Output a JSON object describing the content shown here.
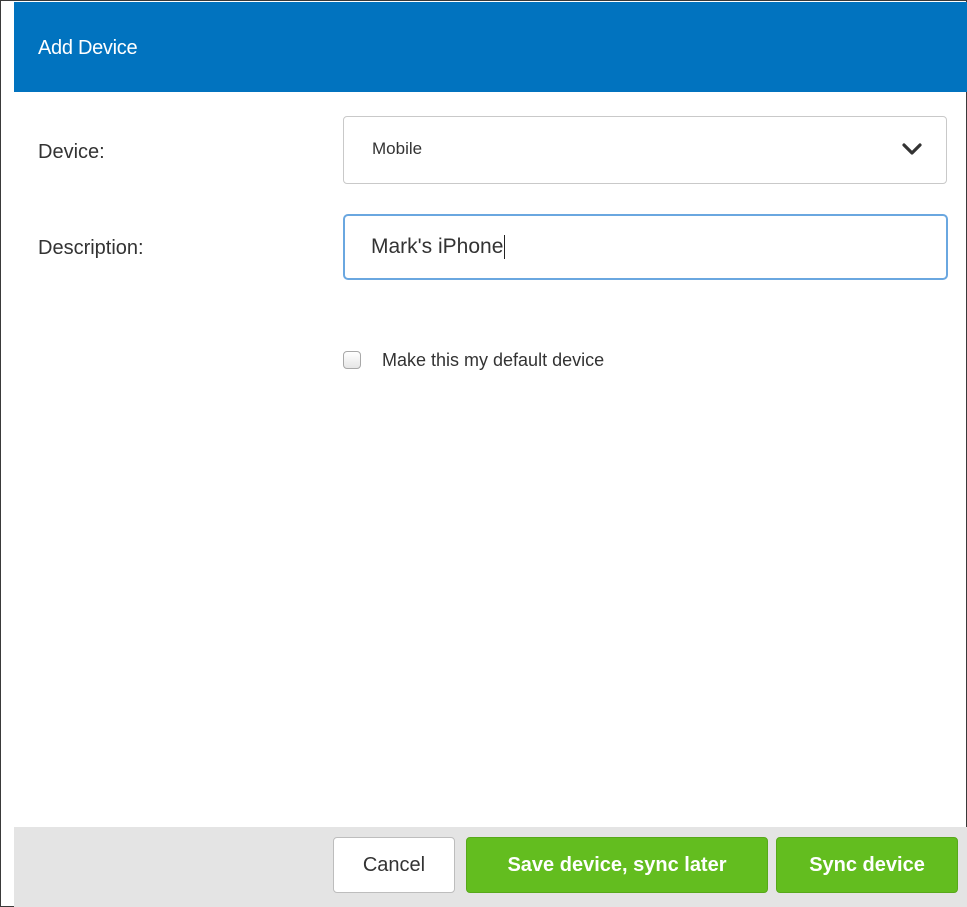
{
  "dialog": {
    "title": "Add Device"
  },
  "form": {
    "device_label": "Device:",
    "device_value": "Mobile",
    "description_label": "Description:",
    "description_value": "Mark's iPhone",
    "default_checkbox_label": "Make this my default device",
    "default_checkbox_checked": false
  },
  "footer": {
    "cancel_label": "Cancel",
    "save_label": "Save device, sync later",
    "sync_label": "Sync device"
  },
  "colors": {
    "header_bg": "#0173bf",
    "primary_button": "#63bd1f",
    "footer_bg": "#e4e4e4"
  },
  "icons": {
    "select_arrow": "chevron-down-icon"
  }
}
